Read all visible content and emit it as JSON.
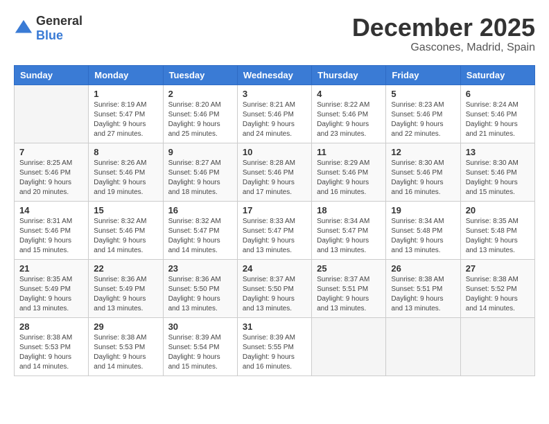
{
  "header": {
    "logo": {
      "text_general": "General",
      "text_blue": "Blue"
    },
    "month": "December 2025",
    "location": "Gascones, Madrid, Spain"
  },
  "calendar": {
    "days_of_week": [
      "Sunday",
      "Monday",
      "Tuesday",
      "Wednesday",
      "Thursday",
      "Friday",
      "Saturday"
    ],
    "weeks": [
      [
        {
          "day": "",
          "sunrise": "",
          "sunset": "",
          "daylight": ""
        },
        {
          "day": "1",
          "sunrise": "Sunrise: 8:19 AM",
          "sunset": "Sunset: 5:47 PM",
          "daylight": "Daylight: 9 hours and 27 minutes."
        },
        {
          "day": "2",
          "sunrise": "Sunrise: 8:20 AM",
          "sunset": "Sunset: 5:46 PM",
          "daylight": "Daylight: 9 hours and 25 minutes."
        },
        {
          "day": "3",
          "sunrise": "Sunrise: 8:21 AM",
          "sunset": "Sunset: 5:46 PM",
          "daylight": "Daylight: 9 hours and 24 minutes."
        },
        {
          "day": "4",
          "sunrise": "Sunrise: 8:22 AM",
          "sunset": "Sunset: 5:46 PM",
          "daylight": "Daylight: 9 hours and 23 minutes."
        },
        {
          "day": "5",
          "sunrise": "Sunrise: 8:23 AM",
          "sunset": "Sunset: 5:46 PM",
          "daylight": "Daylight: 9 hours and 22 minutes."
        },
        {
          "day": "6",
          "sunrise": "Sunrise: 8:24 AM",
          "sunset": "Sunset: 5:46 PM",
          "daylight": "Daylight: 9 hours and 21 minutes."
        }
      ],
      [
        {
          "day": "7",
          "sunrise": "Sunrise: 8:25 AM",
          "sunset": "Sunset: 5:46 PM",
          "daylight": "Daylight: 9 hours and 20 minutes."
        },
        {
          "day": "8",
          "sunrise": "Sunrise: 8:26 AM",
          "sunset": "Sunset: 5:46 PM",
          "daylight": "Daylight: 9 hours and 19 minutes."
        },
        {
          "day": "9",
          "sunrise": "Sunrise: 8:27 AM",
          "sunset": "Sunset: 5:46 PM",
          "daylight": "Daylight: 9 hours and 18 minutes."
        },
        {
          "day": "10",
          "sunrise": "Sunrise: 8:28 AM",
          "sunset": "Sunset: 5:46 PM",
          "daylight": "Daylight: 9 hours and 17 minutes."
        },
        {
          "day": "11",
          "sunrise": "Sunrise: 8:29 AM",
          "sunset": "Sunset: 5:46 PM",
          "daylight": "Daylight: 9 hours and 16 minutes."
        },
        {
          "day": "12",
          "sunrise": "Sunrise: 8:30 AM",
          "sunset": "Sunset: 5:46 PM",
          "daylight": "Daylight: 9 hours and 16 minutes."
        },
        {
          "day": "13",
          "sunrise": "Sunrise: 8:30 AM",
          "sunset": "Sunset: 5:46 PM",
          "daylight": "Daylight: 9 hours and 15 minutes."
        }
      ],
      [
        {
          "day": "14",
          "sunrise": "Sunrise: 8:31 AM",
          "sunset": "Sunset: 5:46 PM",
          "daylight": "Daylight: 9 hours and 15 minutes."
        },
        {
          "day": "15",
          "sunrise": "Sunrise: 8:32 AM",
          "sunset": "Sunset: 5:46 PM",
          "daylight": "Daylight: 9 hours and 14 minutes."
        },
        {
          "day": "16",
          "sunrise": "Sunrise: 8:32 AM",
          "sunset": "Sunset: 5:47 PM",
          "daylight": "Daylight: 9 hours and 14 minutes."
        },
        {
          "day": "17",
          "sunrise": "Sunrise: 8:33 AM",
          "sunset": "Sunset: 5:47 PM",
          "daylight": "Daylight: 9 hours and 13 minutes."
        },
        {
          "day": "18",
          "sunrise": "Sunrise: 8:34 AM",
          "sunset": "Sunset: 5:47 PM",
          "daylight": "Daylight: 9 hours and 13 minutes."
        },
        {
          "day": "19",
          "sunrise": "Sunrise: 8:34 AM",
          "sunset": "Sunset: 5:48 PM",
          "daylight": "Daylight: 9 hours and 13 minutes."
        },
        {
          "day": "20",
          "sunrise": "Sunrise: 8:35 AM",
          "sunset": "Sunset: 5:48 PM",
          "daylight": "Daylight: 9 hours and 13 minutes."
        }
      ],
      [
        {
          "day": "21",
          "sunrise": "Sunrise: 8:35 AM",
          "sunset": "Sunset: 5:49 PM",
          "daylight": "Daylight: 9 hours and 13 minutes."
        },
        {
          "day": "22",
          "sunrise": "Sunrise: 8:36 AM",
          "sunset": "Sunset: 5:49 PM",
          "daylight": "Daylight: 9 hours and 13 minutes."
        },
        {
          "day": "23",
          "sunrise": "Sunrise: 8:36 AM",
          "sunset": "Sunset: 5:50 PM",
          "daylight": "Daylight: 9 hours and 13 minutes."
        },
        {
          "day": "24",
          "sunrise": "Sunrise: 8:37 AM",
          "sunset": "Sunset: 5:50 PM",
          "daylight": "Daylight: 9 hours and 13 minutes."
        },
        {
          "day": "25",
          "sunrise": "Sunrise: 8:37 AM",
          "sunset": "Sunset: 5:51 PM",
          "daylight": "Daylight: 9 hours and 13 minutes."
        },
        {
          "day": "26",
          "sunrise": "Sunrise: 8:38 AM",
          "sunset": "Sunset: 5:51 PM",
          "daylight": "Daylight: 9 hours and 13 minutes."
        },
        {
          "day": "27",
          "sunrise": "Sunrise: 8:38 AM",
          "sunset": "Sunset: 5:52 PM",
          "daylight": "Daylight: 9 hours and 14 minutes."
        }
      ],
      [
        {
          "day": "28",
          "sunrise": "Sunrise: 8:38 AM",
          "sunset": "Sunset: 5:53 PM",
          "daylight": "Daylight: 9 hours and 14 minutes."
        },
        {
          "day": "29",
          "sunrise": "Sunrise: 8:38 AM",
          "sunset": "Sunset: 5:53 PM",
          "daylight": "Daylight: 9 hours and 14 minutes."
        },
        {
          "day": "30",
          "sunrise": "Sunrise: 8:39 AM",
          "sunset": "Sunset: 5:54 PM",
          "daylight": "Daylight: 9 hours and 15 minutes."
        },
        {
          "day": "31",
          "sunrise": "Sunrise: 8:39 AM",
          "sunset": "Sunset: 5:55 PM",
          "daylight": "Daylight: 9 hours and 16 minutes."
        },
        {
          "day": "",
          "sunrise": "",
          "sunset": "",
          "daylight": ""
        },
        {
          "day": "",
          "sunrise": "",
          "sunset": "",
          "daylight": ""
        },
        {
          "day": "",
          "sunrise": "",
          "sunset": "",
          "daylight": ""
        }
      ]
    ]
  }
}
